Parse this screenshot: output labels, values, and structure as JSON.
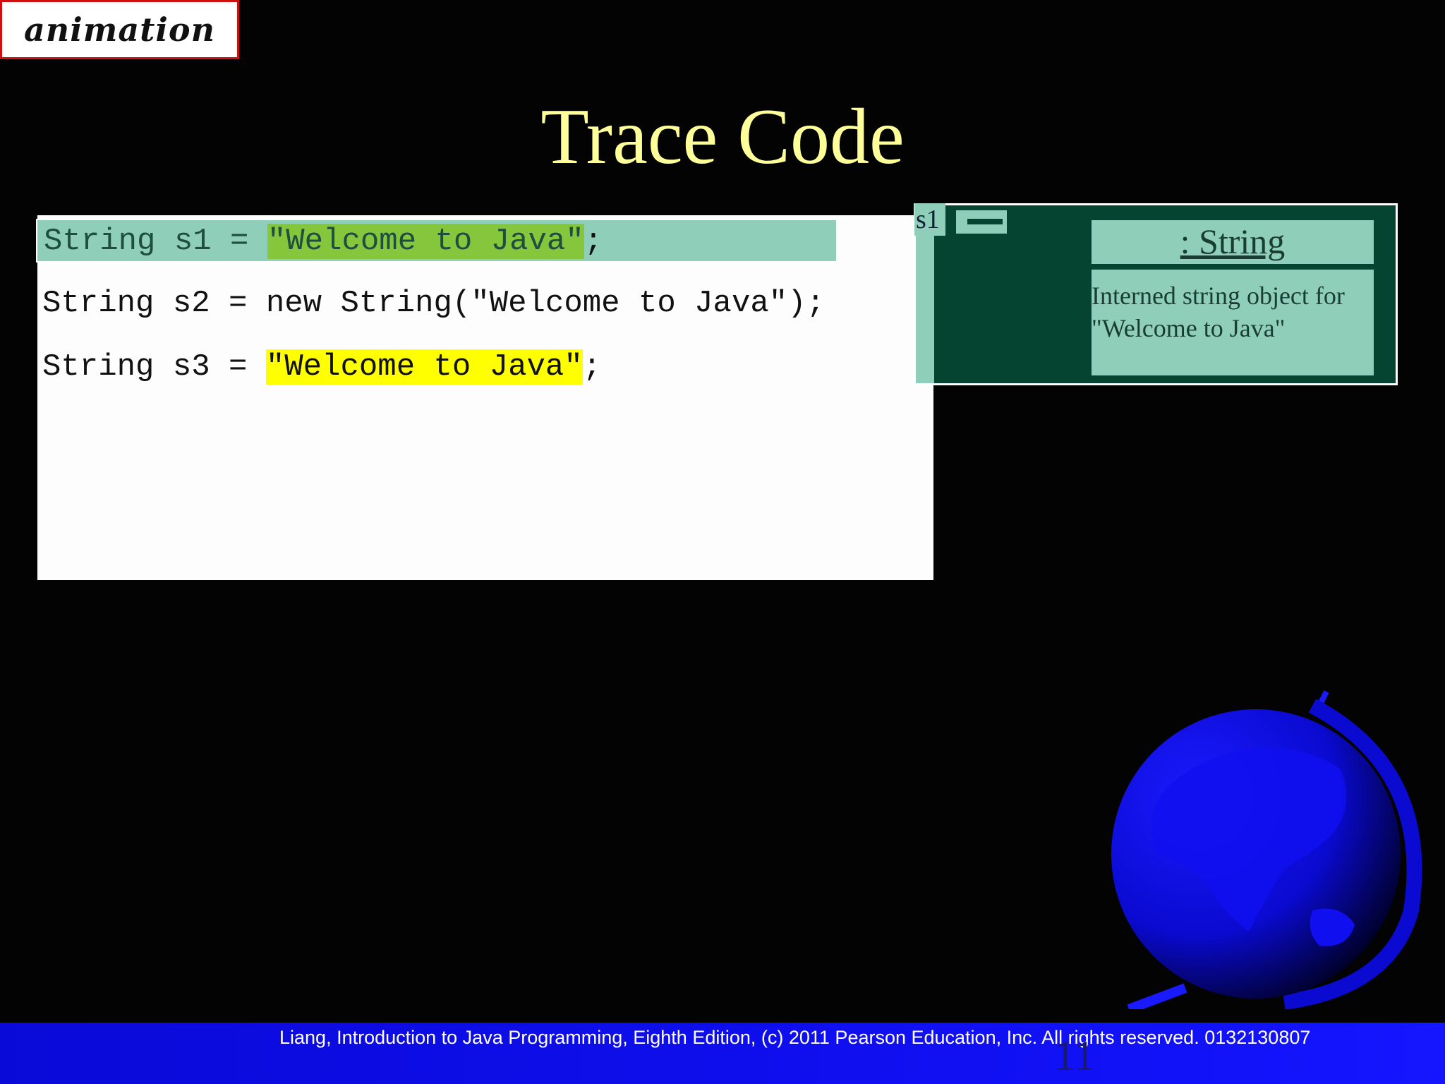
{
  "badge": {
    "label": "animation"
  },
  "slide": {
    "title": "Trace Code",
    "page_number": "11"
  },
  "code": {
    "line1": {
      "prefix": "String s1 = ",
      "literal": "\"Welcome to Java\"",
      "suffix": ";"
    },
    "line2": {
      "text": "String s2 = new String(\"Welcome to Java\");"
    },
    "line3": {
      "prefix": "String s3 = ",
      "literal": "\"Welcome to Java\"",
      "suffix": ";"
    }
  },
  "memory": {
    "variable": "s1",
    "object_header": ": String",
    "object_body_line1": "Interned string object for",
    "object_body_line2": "\"Welcome to Java\""
  },
  "footer": {
    "text": "Liang, Introduction to Java Programming, Eighth Edition, (c) 2011 Pearson Education, Inc. All rights reserved. 0132130807"
  },
  "colors": {
    "title": "#ffff99",
    "background": "#030303",
    "highlight_current": "#8fcfba",
    "highlight_green": "#86c63c",
    "highlight_yellow": "#ffff00",
    "memory_panel": "#044431",
    "footer_bar": "#0f0ff0"
  },
  "icons": {
    "globe": "globe-icon"
  }
}
